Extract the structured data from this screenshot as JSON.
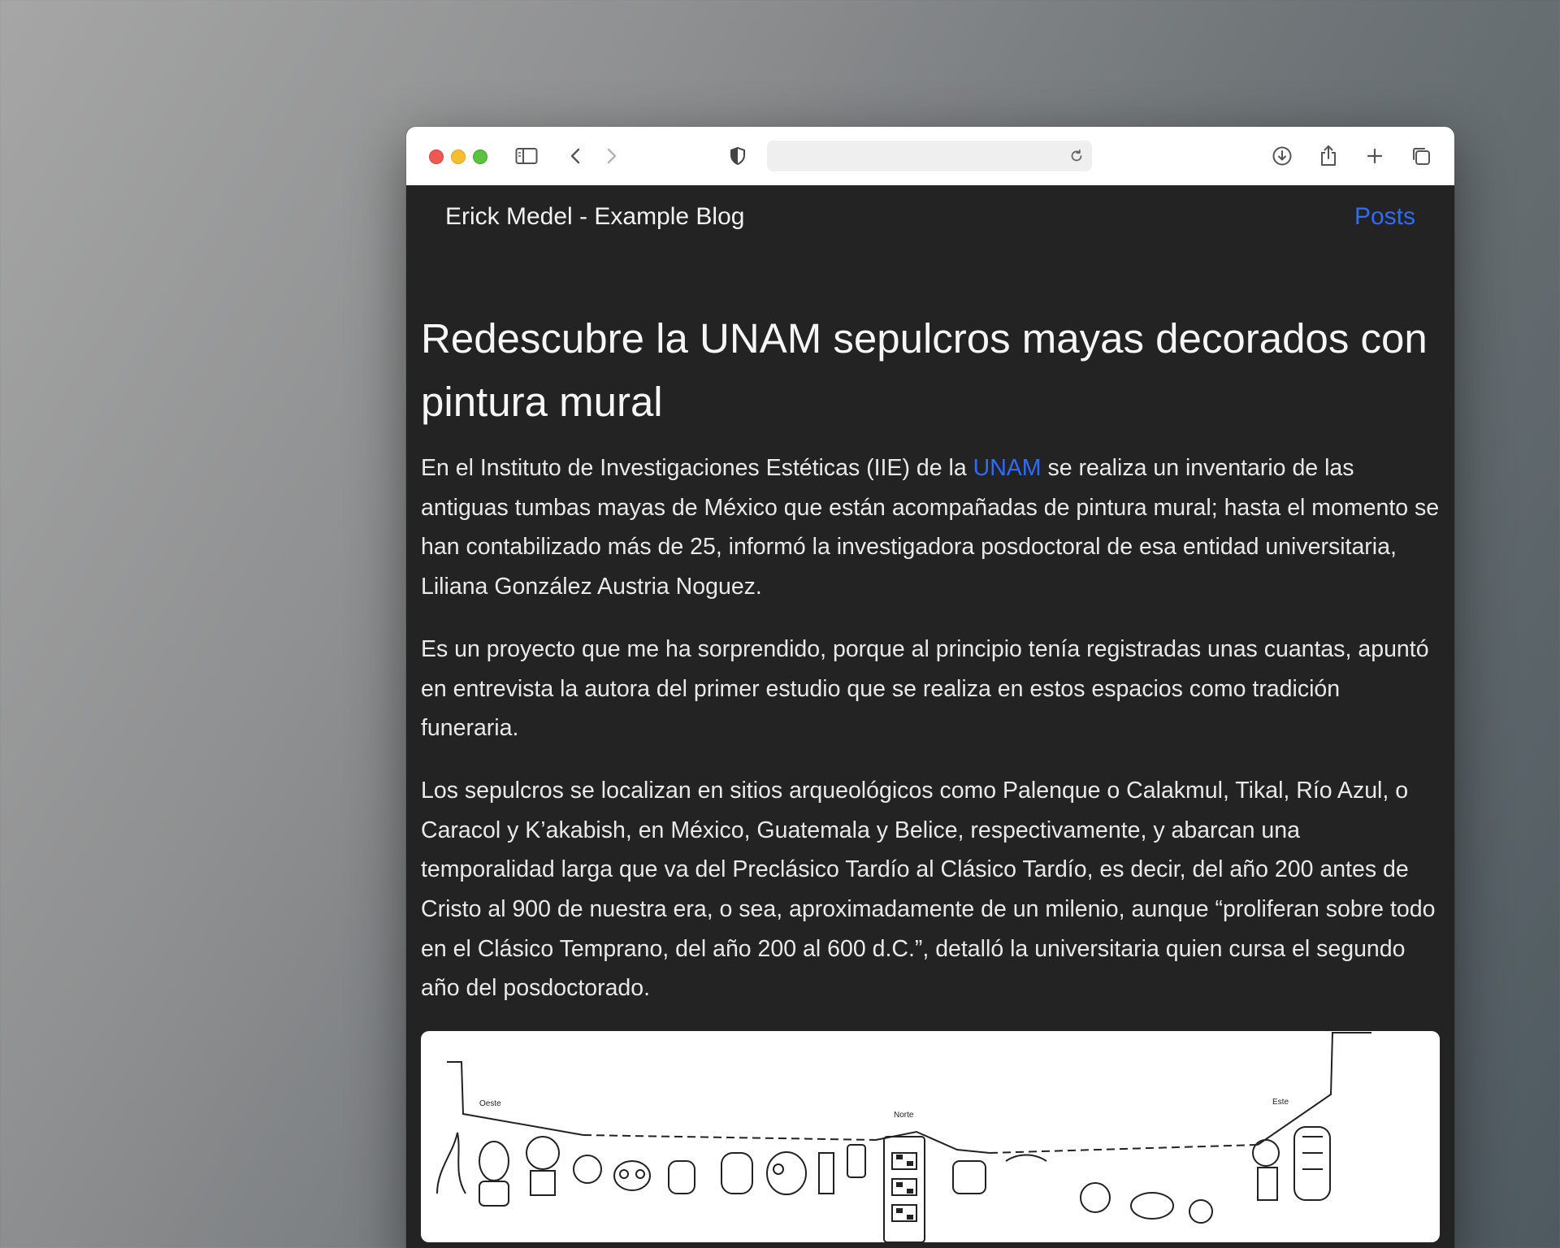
{
  "browser": {
    "address_value": "",
    "address_placeholder": ""
  },
  "site": {
    "brand": "Erick Medel - Example Blog",
    "nav_link": "Posts"
  },
  "article": {
    "title": "Redescubre la UNAM sepulcros mayas decorados con pintura mural",
    "p1_before_link": "En el Instituto de Investigaciones Estéticas (IIE) de la ",
    "p1_link": "UNAM",
    "p1_after_link": " se realiza un inventario de las antiguas tumbas mayas de México que están acompañadas de pintura mural; hasta el momento se han contabilizado más de 25, informó la investigadora posdoctoral de esa entidad universitaria, Liliana González Austria Noguez.",
    "p2": "Es un proyecto que me ha sorprendido, porque al principio tenía registradas unas cuantas, apuntó en entrevista la autora del primer estudio que se realiza en estos espacios como tradición funeraria.",
    "p3": "Los sepulcros se localizan en sitios arqueológicos como Palenque o Calakmul, Tikal, Río Azul, o Caracol y K’akabish, en México, Guatemala y Belice, respectivamente, y abarcan una temporalidad larga que va del Preclásico Tardío al Clásico Tardío, es decir, del año 200 antes de Cristo al 900 de nuestra era, o sea, aproximadamente de un milenio, aunque “proliferan sobre todo en el Clásico Temprano, del año 200 al 600 d.C.”, detalló la universitaria quien cursa el segundo año del posdoctorado.",
    "figure_labels": {
      "west": "Oeste",
      "north": "Norte",
      "east": "Este"
    }
  },
  "colors": {
    "page_background": "#232323",
    "link": "#2f6bff",
    "toolbar": "#ffffff"
  },
  "icons": [
    "sidebar-icon",
    "back-icon",
    "forward-icon",
    "shield-icon",
    "reload-icon",
    "download-icon",
    "share-icon",
    "new-tab-icon",
    "tabs-overview-icon"
  ]
}
